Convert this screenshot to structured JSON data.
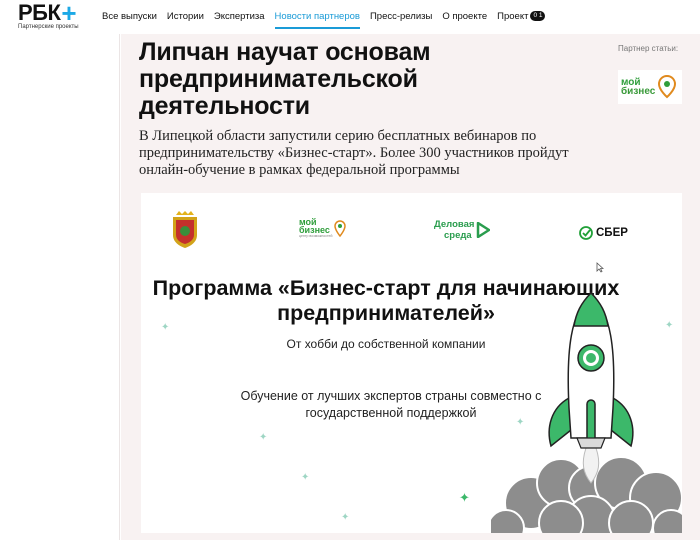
{
  "header": {
    "logo_main": "РБК",
    "logo_plus": "+",
    "logo_sub": "Партнерские проекты",
    "nav": [
      {
        "label": "Все выпуски",
        "active": false
      },
      {
        "label": "Истории",
        "active": false
      },
      {
        "label": "Экспертиза",
        "active": false
      },
      {
        "label": "Новости партнеров",
        "active": true
      },
      {
        "label": "Пресс-релизы",
        "active": false
      },
      {
        "label": "О проекте",
        "active": false
      },
      {
        "label": "Проект",
        "active": false
      }
    ],
    "project_badge": "0 1",
    "accent_color": "#1a9bd7"
  },
  "article": {
    "title": "Липчан научат основам предпринимательской деятельности",
    "lead": "В Липецкой области запустили серию бесплатных вебинаров по предпринимательству «Бизнес-старт». Более 300 участников пройдут онлайн-обучение в рамках федеральной программы"
  },
  "partner": {
    "label": "Партнер статьи:",
    "logo_line1": "мой",
    "logo_line2": "бизнес"
  },
  "banner": {
    "logos": {
      "moy_biznes_line1": "мой",
      "moy_biznes_line2": "бизнес",
      "moy_biznes_sub": "центр возможностей",
      "delovaya_line1": "Деловая",
      "delovaya_line2": "среда",
      "sber": "СБЕР"
    },
    "title_line1": "Программа «Бизнес-старт для начинающих",
    "title_line2": "предпринимателей»",
    "subtitle": "От хобби до собственной компании",
    "desc_line1": "Обучение от лучших экспертов страны совместно с",
    "desc_line2": "государственной поддержкой",
    "rocket_color": "#3cb86a",
    "smoke_color": "#8a8a8a"
  }
}
